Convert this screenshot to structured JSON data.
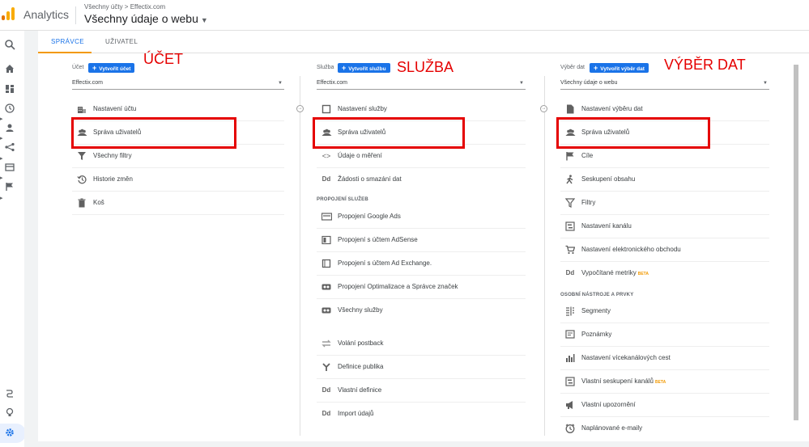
{
  "header": {
    "app_title": "Analytics",
    "breadcrumb": "Všechny účty > Effectix.com",
    "view_selector": "Všechny údaje o webu"
  },
  "tabs": [
    {
      "label": "SPRÁVCE",
      "active": true
    },
    {
      "label": "UŽIVATEL",
      "active": false
    }
  ],
  "account": {
    "heading": "Účet",
    "create_label": "Vytvořit účet",
    "selected": "Effectix.com",
    "items": [
      {
        "label": "Nastavení účtu",
        "icon": "building-icon"
      },
      {
        "label": "Správa uživatelů",
        "icon": "people-icon"
      },
      {
        "label": "Všechny filtry",
        "icon": "filter-icon"
      },
      {
        "label": "Historie změn",
        "icon": "history-icon"
      },
      {
        "label": "Koš",
        "icon": "trash-icon"
      }
    ]
  },
  "property": {
    "heading": "Služba",
    "create_label": "Vytvořit službu",
    "selected": "Effectix.com",
    "items": [
      {
        "label": "Nastavení služby",
        "icon": "square-icon"
      },
      {
        "label": "Správa uživatelů",
        "icon": "people-icon"
      },
      {
        "label": "Údaje o měření",
        "icon": "code-icon"
      },
      {
        "label": "Žádosti o smazání dat",
        "icon": "dd-icon"
      }
    ],
    "section_label": "PROPOJENÍ SLUŽEB",
    "link_items": [
      {
        "label": "Propojení Google Ads",
        "icon": "ads-icon"
      },
      {
        "label": "Propojení s účtem AdSense",
        "icon": "adsense-icon"
      },
      {
        "label": "Propojení s účtem Ad Exchange.",
        "icon": "adx-icon"
      },
      {
        "label": "Propojení Optimalizace a Správce značek",
        "icon": "link-icon"
      },
      {
        "label": "Všechny služby",
        "icon": "link-icon"
      }
    ],
    "extra_items": [
      {
        "label": "Volání postback",
        "icon": "swap-icon"
      },
      {
        "label": "Definice publika",
        "icon": "fork-icon"
      },
      {
        "label": "Vlastní definice",
        "icon": "dd-icon"
      },
      {
        "label": "Import údajů",
        "icon": "dd-icon"
      }
    ]
  },
  "view": {
    "heading": "Výběr dat",
    "create_label": "Vytvořit výběr dat",
    "selected": "Všechny údaje o webu",
    "items": [
      {
        "label": "Nastavení výběru dat",
        "icon": "document-icon"
      },
      {
        "label": "Správa uživatelů",
        "icon": "people-icon"
      },
      {
        "label": "Cíle",
        "icon": "flag-icon"
      },
      {
        "label": "Seskupení obsahu",
        "icon": "person-walk-icon"
      },
      {
        "label": "Filtry",
        "icon": "filter-icon"
      },
      {
        "label": "Nastavení kanálu",
        "icon": "channel-icon"
      },
      {
        "label": "Nastavení elektronického obchodu",
        "icon": "cart-icon"
      },
      {
        "label": "Vypočítané metriky",
        "icon": "dd-icon",
        "badge": "BETA"
      }
    ],
    "section_label": "OSOBNÍ NÁSTROJE A PRVKY",
    "personal_items": [
      {
        "label": "Segmenty",
        "icon": "segments-icon"
      },
      {
        "label": "Poznámky",
        "icon": "notes-icon"
      },
      {
        "label": "Nastavení vícekanálových cest",
        "icon": "bar-chart-icon"
      },
      {
        "label": "Vlastní seskupení kanálů",
        "icon": "channel-icon",
        "badge": "BETA"
      },
      {
        "label": "Vlastní upozornění",
        "icon": "megaphone-icon"
      },
      {
        "label": "Naplánované e-maily",
        "icon": "clock-icon"
      }
    ]
  },
  "annotations": {
    "account_label": "ÚČET",
    "property_label": "SLUŽBA",
    "view_label": "VÝBĚR DAT",
    "color": "#e50000"
  },
  "colors": {
    "accent_blue": "#1a73e8",
    "tab_indicator": "#f29900",
    "logo_orange": "#f9ab00",
    "logo_dark": "#e37400"
  }
}
